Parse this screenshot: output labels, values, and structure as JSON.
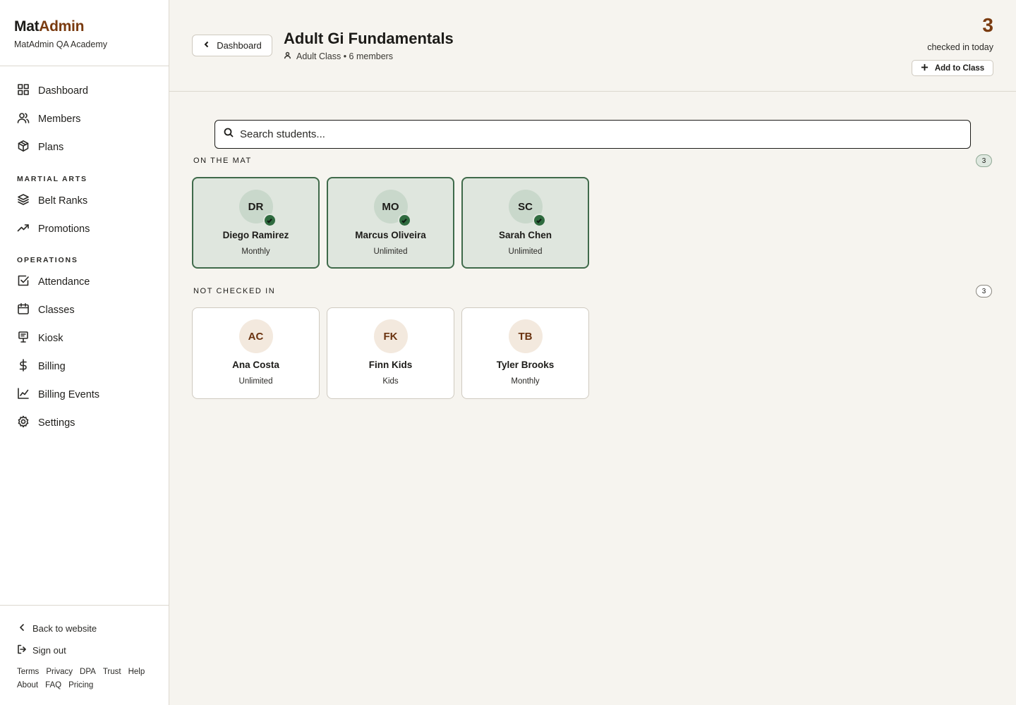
{
  "brand": {
    "name_part1": "Mat",
    "name_part2": "Admin",
    "academy": "MatAdmin QA Academy"
  },
  "nav": {
    "main": [
      {
        "label": "Dashboard",
        "icon": "grid-icon"
      },
      {
        "label": "Members",
        "icon": "users-icon"
      },
      {
        "label": "Plans",
        "icon": "box-icon"
      }
    ],
    "section_martial_arts": "MARTIAL ARTS",
    "martial_arts": [
      {
        "label": "Belt Ranks",
        "icon": "layers-icon"
      },
      {
        "label": "Promotions",
        "icon": "trending-up-icon"
      }
    ],
    "section_operations": "OPERATIONS",
    "operations": [
      {
        "label": "Attendance",
        "icon": "check-square-icon"
      },
      {
        "label": "Classes",
        "icon": "calendar-icon"
      },
      {
        "label": "Kiosk",
        "icon": "kiosk-icon"
      },
      {
        "label": "Billing",
        "icon": "dollar-icon"
      },
      {
        "label": "Billing Events",
        "icon": "line-chart-icon"
      },
      {
        "label": "Settings",
        "icon": "gear-icon"
      }
    ]
  },
  "footer": {
    "back_to_website": "Back to website",
    "sign_out": "Sign out",
    "legal_row1": [
      "Terms",
      "Privacy",
      "DPA",
      "Trust",
      "Help"
    ],
    "legal_row2": [
      "About",
      "FAQ",
      "Pricing"
    ]
  },
  "header": {
    "back_label": "Dashboard",
    "title": "Adult Gi Fundamentals",
    "meta": "Adult Class • 6 members",
    "checked_in_count": "3",
    "checked_in_label": "checked in today",
    "add_label": "Add to Class"
  },
  "search": {
    "placeholder": "Search students..."
  },
  "on_the_mat": {
    "title": "ON THE MAT",
    "count": "3",
    "students": [
      {
        "initials": "DR",
        "name": "Diego Ramirez",
        "plan": "Monthly"
      },
      {
        "initials": "MO",
        "name": "Marcus Oliveira",
        "plan": "Unlimited"
      },
      {
        "initials": "SC",
        "name": "Sarah Chen",
        "plan": "Unlimited"
      }
    ]
  },
  "not_checked_in": {
    "title": "NOT CHECKED IN",
    "count": "3",
    "students": [
      {
        "initials": "AC",
        "name": "Ana Costa",
        "plan": "Unlimited"
      },
      {
        "initials": "FK",
        "name": "Finn Kids",
        "plan": "Kids"
      },
      {
        "initials": "TB",
        "name": "Tyler Brooks",
        "plan": "Monthly"
      }
    ]
  },
  "colors": {
    "accent_brown": "#7a3b10",
    "checked_in_green": "#2f6b3f",
    "checked_card_bg": "#dfe6de",
    "page_bg": "#f6f4ef"
  }
}
